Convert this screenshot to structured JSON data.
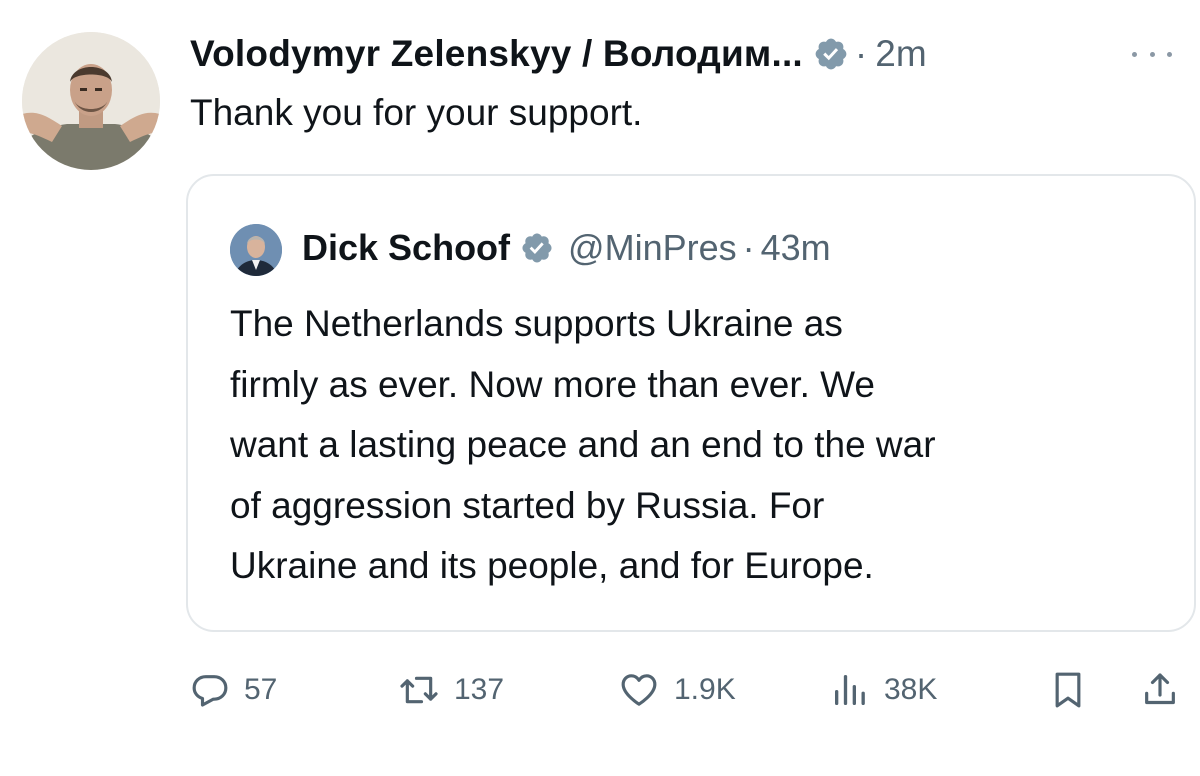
{
  "post": {
    "author_name": "Volodymyr Zelenskyy / Володим...",
    "separator": "·",
    "time": "2m",
    "text": "Thank you for your support."
  },
  "quoted_post": {
    "author_name": "Dick Schoof",
    "handle": "@MinPres",
    "separator": "·",
    "time": "43m",
    "lines": [
      "The Netherlands supports Ukraine as",
      "firmly as ever. Now more than ever. We",
      "want a lasting peace and an end to the war",
      "of aggression started by Russia. For",
      "Ukraine and its people, and for Europe."
    ]
  },
  "actions": {
    "replies": "57",
    "reposts": "137",
    "likes": "1.9K",
    "views": "38K"
  },
  "icons": {
    "verified": "verified-badge-icon",
    "reply": "reply-icon",
    "repost": "repost-icon",
    "like": "heart-icon",
    "views": "views-icon",
    "bookmark": "bookmark-icon",
    "share": "share-icon",
    "more": "more-icon"
  },
  "colors": {
    "text": "#0f1419",
    "secondary": "#536471",
    "verified_badge": "#829aab",
    "border": "#e3e7ea"
  }
}
